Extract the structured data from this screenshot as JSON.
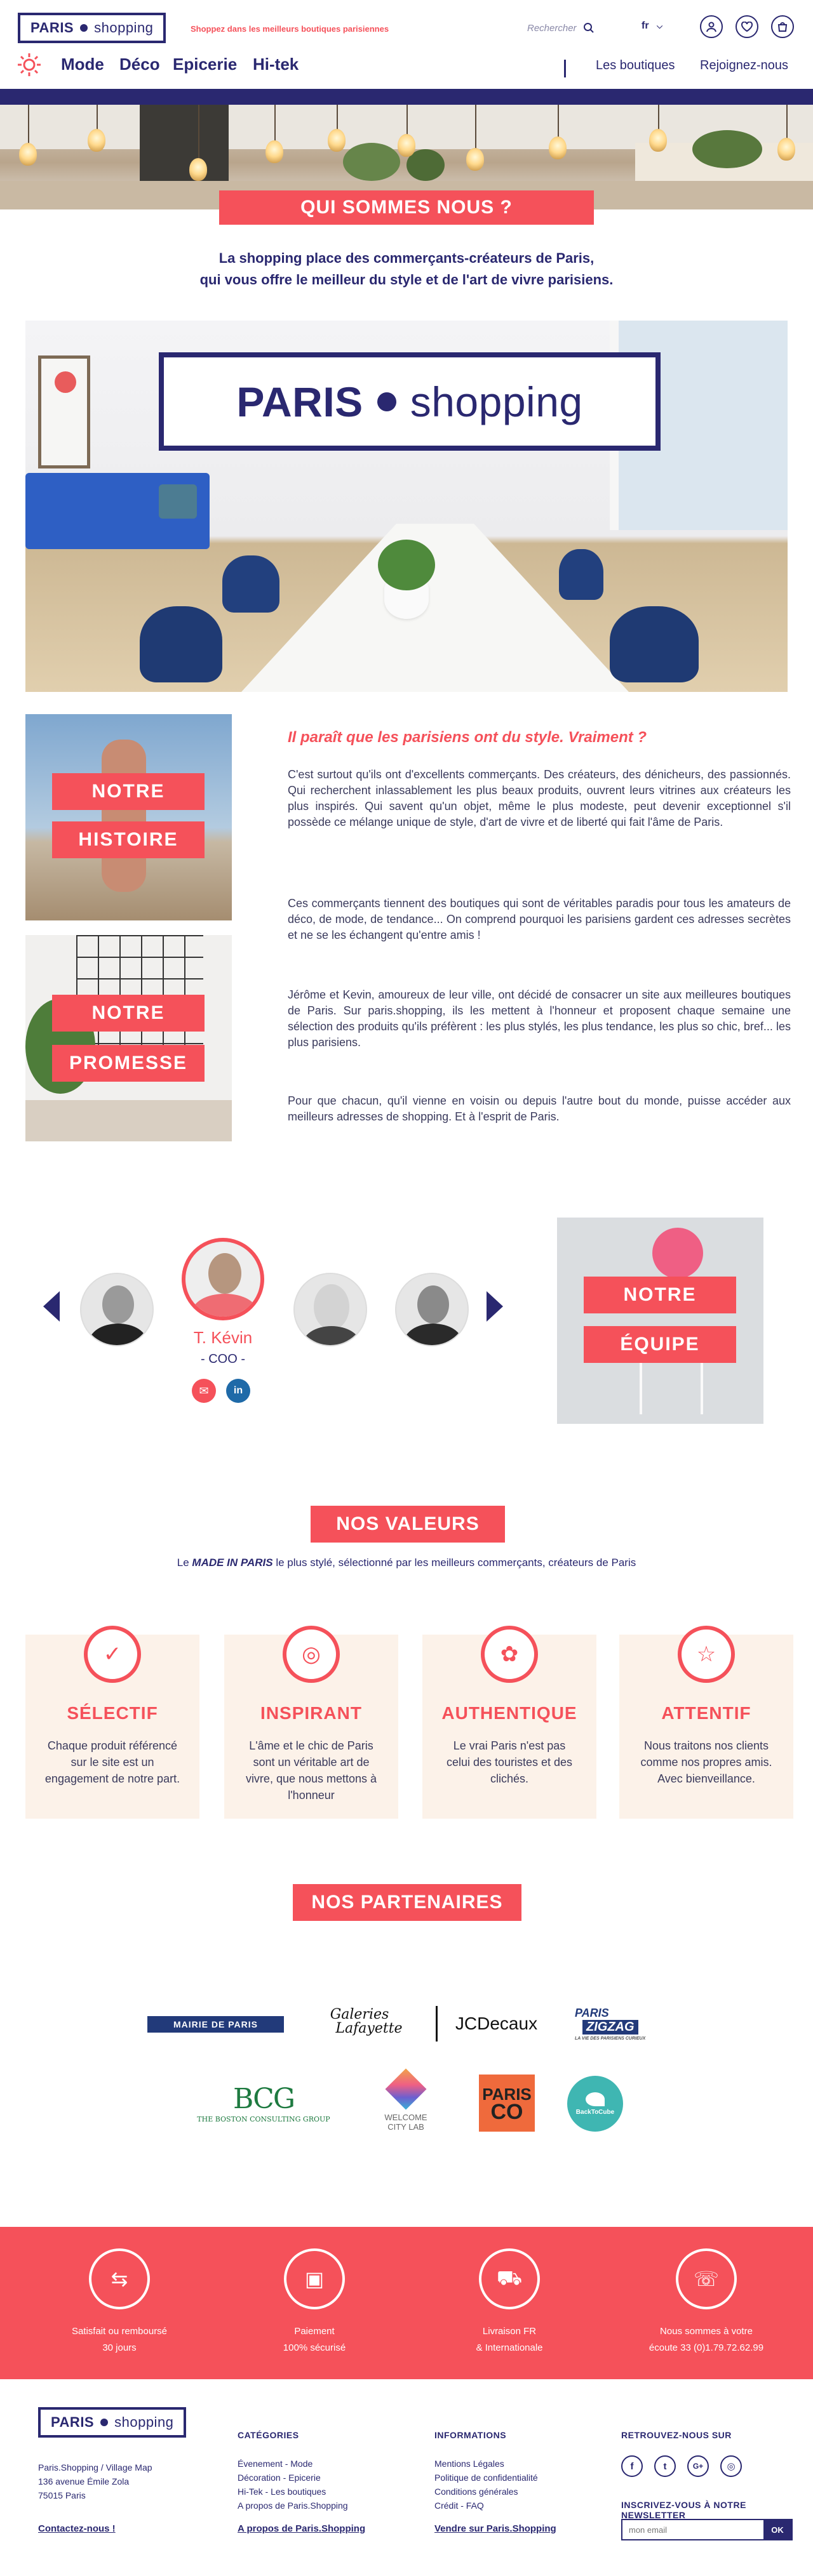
{
  "header": {
    "logo": {
      "bold": "PARIS",
      "light": "shopping"
    },
    "tagline": "Shoppez dans les meilleurs boutiques parisiennes",
    "search_placeholder": "Rechercher",
    "lang": "fr",
    "nav": [
      "Mode",
      "Déco",
      "Epicerie",
      "Hi-tek"
    ],
    "nav_right": [
      "Les boutiques",
      "Rejoignez-nous"
    ]
  },
  "about": {
    "tag": "QUI SOMMES NOUS ?",
    "intro_line1": "La shopping place des commerçants-créateurs de Paris,",
    "intro_line2": "qui vous offre le meilleur du style et de l'art de vivre parisiens."
  },
  "office_logo": {
    "bold": "PARIS",
    "light": "shopping"
  },
  "story": {
    "btn1a": "NOTRE",
    "btn1b": "HISTOIRE",
    "btn2a": "NOTRE",
    "btn2b": "PROMESSE",
    "title": "Il paraît que les parisiens ont du style. Vraiment ?",
    "p1": "C'est surtout qu'ils ont d'excellents commerçants. Des créateurs, des dénicheurs, des passionnés. Qui recherchent inlassablement les plus beaux produits, ouvrent leurs vitrines aux créateurs les plus inspirés. Qui savent qu'un objet, même le plus modeste, peut devenir exceptionnel s'il possède ce mélange unique de style, d'art de vivre et de liberté qui fait l'âme de Paris.",
    "p2": "Ces commerçants tiennent des boutiques qui sont de véritables paradis pour tous les amateurs de déco, de mode, de tendance... On comprend pourquoi les parisiens gardent ces adresses secrètes et ne se les échangent qu'entre amis !",
    "p3": "Jérôme et Kevin, amoureux de leur ville, ont décidé de consacrer un site aux meilleures boutiques de Paris. Sur paris.shopping, ils les mettent à l'honneur et proposent chaque semaine une sélection des produits qu'ils préfèrent : les plus stylés, les plus tendance, les plus so chic, bref... les plus parisiens.",
    "p4": "Pour que chacun, qu'il vienne en voisin ou depuis l'autre bout du monde, puisse accéder aux meilleurs adresses de shopping. Et à l'esprit de Paris."
  },
  "team": {
    "name": "T. Kévin",
    "role": "- COO -",
    "social": [
      "✉",
      "in"
    ],
    "btn_a": "NOTRE",
    "btn_b": "ÉQUIPE"
  },
  "values": {
    "tag": "NOS VALEURS",
    "subtitle_pre": "Le ",
    "subtitle_em": "MADE IN PARIS",
    "subtitle_post": " le plus stylé, sélectionné par les meilleurs commerçants, créateurs de Paris",
    "items": [
      {
        "title": "SÉLECTIF",
        "text": "Chaque produit référencé sur le site est un engagement de notre part.",
        "icon": "check-icon"
      },
      {
        "title": "INSPIRANT",
        "text": "L'âme et le chic de Paris sont un véritable art de vivre, que nous mettons à l'honneur",
        "icon": "lightbulb-icon"
      },
      {
        "title": "AUTHENTIQUE",
        "text": "Le vrai Paris n'est pas celui des touristes et des clichés.",
        "icon": "medal-icon"
      },
      {
        "title": "ATTENTIF",
        "text": "Nous traitons nos clients comme nos propres amis. Avec bienveillance.",
        "icon": "star-icon"
      }
    ]
  },
  "partners": {
    "tag": "NOS PARTENAIRES",
    "logos": [
      {
        "a": "MAIRIE DE PARIS"
      },
      {
        "a": "Galeries",
        "b": "Lafayette"
      },
      {
        "a": "JCDecaux"
      },
      {
        "a": "PARIS",
        "b": "ZIGZAG",
        "c": "LA VIE DES PARISIENS CURIEUX"
      },
      {
        "a": "BCG",
        "b": "THE BOSTON CONSULTING GROUP"
      },
      {
        "a": "WELCOME",
        "b": "CITY LAB"
      },
      {
        "a": "PARIS",
        "b": "CO"
      },
      {
        "a": "BackToCube"
      }
    ]
  },
  "reassurance": [
    {
      "l1": "Satisfait ou remboursé",
      "l2": "30 jours",
      "icon": "return-icon"
    },
    {
      "l1": "Paiement",
      "l2": "100% sécurisé",
      "icon": "card-icon"
    },
    {
      "l1": "Livraison FR",
      "l2": "& Internationale",
      "icon": "truck-icon"
    },
    {
      "l1": "Nous sommes à votre",
      "l2": "écoute 33 (0)1.79.72.62.99",
      "icon": "headset-icon"
    }
  ],
  "footer": {
    "logo": {
      "bold": "PARIS",
      "light": "shopping"
    },
    "address": [
      "Paris.Shopping / Village Map",
      "136 avenue Émile Zola",
      "75015 Paris"
    ],
    "contact": "Contactez-nous !",
    "cat_head": "CATÉGORIES",
    "categories": [
      "Évenement - Mode",
      "Décoration - Epicerie",
      "Hi-Tek - Les boutiques",
      "A propos de Paris.Shopping"
    ],
    "cat_link": "A propos de Paris.Shopping",
    "info_head": "INFORMATIONS",
    "infos": [
      "Mentions Légales",
      "Politique de confidentialité",
      "Conditions générales",
      "Crédit - FAQ"
    ],
    "info_link": "Vendre sur Paris.Shopping",
    "social_head": "RETROUVEZ-NOUS SUR",
    "social": [
      "f",
      "t",
      "G+",
      "◎"
    ],
    "news_head": "INSCRIVEZ-VOUS À NOTRE NEWSLETTER",
    "news_placeholder": "mon email",
    "news_btn": "OK"
  }
}
